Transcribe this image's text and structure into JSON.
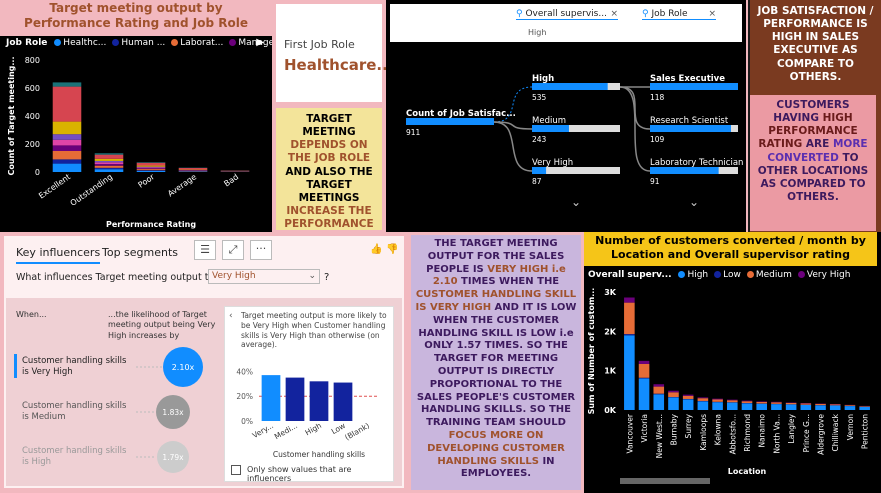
{
  "chart1": {
    "title": "Target meeting output by Performance Rating and Job Role",
    "legend_title": "Job Role",
    "legend": [
      {
        "name": "Healthc...",
        "color": "#118DFF"
      },
      {
        "name": "Human ...",
        "color": "#12239E"
      },
      {
        "name": "Laborat...",
        "color": "#E66C37"
      },
      {
        "name": "Manager",
        "color": "#6B007B"
      }
    ],
    "ylabel": "Count of Target meeting...",
    "xlabel": "Performance Rating"
  },
  "chart_data": [
    {
      "type": "bar",
      "stacked": true,
      "title": "Target meeting output by Performance Rating and Job Role",
      "xlabel": "Performance Rating",
      "ylabel": "Count of Target meeting...",
      "categories": [
        "Excellent",
        "Outstanding",
        "Poor",
        "Average",
        "Bad"
      ],
      "ylim": [
        0,
        800
      ],
      "yticks": [
        "0",
        "200",
        "400",
        "600",
        "800"
      ],
      "segment_colors": [
        "#118DFF",
        "#12239E",
        "#E66C37",
        "#6B007B",
        "#E044A7",
        "#744EC2",
        "#D9B300",
        "#D64550",
        "#197278"
      ],
      "stacks": [
        [
          60,
          30,
          60,
          40,
          40,
          40,
          90,
          250,
          30
        ],
        [
          20,
          10,
          15,
          12,
          12,
          10,
          15,
          30,
          10
        ],
        [
          8,
          5,
          8,
          6,
          6,
          5,
          8,
          20,
          4
        ],
        [
          3,
          2,
          3,
          2,
          2,
          2,
          3,
          12,
          2
        ],
        [
          1,
          1,
          1,
          1,
          1,
          1,
          1,
          3,
          1
        ]
      ]
    },
    {
      "type": "bar",
      "stacked": true,
      "title": "Number of customers converted / month by Location and Overall supervisor rating",
      "xlabel": "Location",
      "ylabel": "Sum of Number of custom...",
      "legend_title": "Overall superv...",
      "series_names": [
        "High",
        "Low",
        "Medium",
        "Very High"
      ],
      "colors": [
        "#118DFF",
        "#12239E",
        "#E66C37",
        "#6B007B"
      ],
      "categories": [
        "Vancouver",
        "Victoria",
        "New West...",
        "Burnaby",
        "Surrey",
        "Kamloops",
        "Kelowna",
        "Abbotsfo...",
        "Richmond",
        "Nanaimo",
        "North Va...",
        "Langley",
        "Prince G...",
        "Aldergrove",
        "Chilliwack",
        "Vernon",
        "Penticton"
      ],
      "ylim": [
        0,
        3000
      ],
      "yticks": [
        "0K",
        "1K",
        "2K",
        "3K"
      ],
      "stacks": [
        [
          1900,
          30,
          800,
          130
        ],
        [
          800,
          20,
          350,
          80
        ],
        [
          400,
          15,
          180,
          60
        ],
        [
          320,
          10,
          120,
          40
        ],
        [
          270,
          10,
          80,
          30
        ],
        [
          220,
          10,
          70,
          20
        ],
        [
          200,
          8,
          60,
          20
        ],
        [
          190,
          8,
          50,
          15
        ],
        [
          170,
          8,
          45,
          15
        ],
        [
          160,
          6,
          40,
          12
        ],
        [
          150,
          6,
          40,
          12
        ],
        [
          140,
          6,
          35,
          10
        ],
        [
          130,
          5,
          30,
          10
        ],
        [
          120,
          5,
          30,
          8
        ],
        [
          115,
          5,
          25,
          8
        ],
        [
          100,
          5,
          20,
          6
        ],
        [
          80,
          4,
          15,
          5
        ]
      ]
    }
  ],
  "card": {
    "label": "First Job Role",
    "value": "Healthcare..."
  },
  "note1": {
    "parts": [
      {
        "t": "TARGET MEETING ",
        "c": "#000"
      },
      {
        "t": "DEPENDS ON THE JOB ROLE",
        "c": "#a0522d"
      },
      {
        "t": " AND ALSO THE TARGET MEETINGS ",
        "c": "#000"
      },
      {
        "t": "INCREASE THE PERFORMANCE RATING.",
        "c": "#a0522d"
      }
    ]
  },
  "decomp": {
    "filter1": "Overall supervis...",
    "filter1_sub": "High",
    "filter2": "Job Role",
    "root": {
      "label": "Count of Job Satisfac...",
      "value": "911"
    },
    "level1": [
      {
        "label": "High",
        "value": "535",
        "bold": true
      },
      {
        "label": "Medium",
        "value": "243",
        "bold": false
      },
      {
        "label": "Very High",
        "value": "87",
        "bold": false
      }
    ],
    "level2": [
      {
        "label": "Sales Executive",
        "value": "118",
        "bold": true
      },
      {
        "label": "Research Scientist",
        "value": "109",
        "bold": false
      },
      {
        "label": "Laboratory Technician",
        "value": "91",
        "bold": false
      }
    ]
  },
  "note_top_right": "JOB SATISFACTION / PERFORMANCE IS HIGH IN SALES EXECUTIVE AS COMPARE TO OTHERS.",
  "note_right": {
    "parts": [
      {
        "t": "CUSTOMERS HAVING ",
        "c": "#3d1a5e"
      },
      {
        "t": "HIGH PERFORMANCE RATING",
        "c": "#6a1b1b"
      },
      {
        "t": " ARE ",
        "c": "#3d1a5e"
      },
      {
        "t": "MORE CONVERTED",
        "c": "#5b2fb0"
      },
      {
        "t": " TO OTHER LOCATIONS AS COMPARED TO OTHERS.",
        "c": "#3d1a5e"
      }
    ]
  },
  "ki": {
    "tab1": "Key influencers",
    "tab2": "Top segments",
    "question": "What influences Target meeting output to be",
    "question_value": "Very High",
    "question_mark": "?",
    "col1": "When...",
    "col2": "...the likelihood of Target meeting output being Very High increases by",
    "influencers": [
      {
        "label": "Customer handling skills is Very High",
        "value": "2.10x"
      },
      {
        "label": "Customer handling skills is Medium",
        "value": "1.83x"
      },
      {
        "label": "Customer handling skills is High",
        "value": "1.79x"
      }
    ],
    "detail_text": "Target meeting output is more likely to be Very High when Customer handling skills is Very High than otherwise (on average).",
    "detail_xlabel": "Customer handling skills",
    "detail_categories": [
      "Very...",
      "Medi...",
      "High",
      "Low",
      "(Blank)"
    ],
    "detail_values": [
      37,
      35,
      32,
      31,
      0
    ],
    "detail_yticks": [
      "20%",
      "40%",
      "0%"
    ],
    "checkbox_label": "Only show values that are influencers"
  },
  "note_mid": {
    "parts": [
      {
        "t": "THE TARGET MEETING OUTPUT FOR THE SALES PEOPLE IS ",
        "c": "#3d1a5e"
      },
      {
        "t": "VERY HIGH i.e 2.10",
        "c": "#a0522d"
      },
      {
        "t": "  TIMES WHEN THE ",
        "c": "#3d1a5e"
      },
      {
        "t": "CUSTOMER HANDLING SKILL IS VERY HIGH",
        "c": "#a0522d"
      },
      {
        "t": " AND IT IS LOW WHEN THE CUSTOMER HANDLING SKILL IS LOW i.e ONLY 1.57 TIMES. SO THE TARGET FOR MEETING OUTPUT IS DIRECTLY PROPORTIONAL TO THE SALES PEOPLE'S CUSTOMER HANDLING SKILLS.  SO THE TRAINING TEAM SHOULD ",
        "c": "#3d1a5e"
      },
      {
        "t": "FOCUS MORE ON DEVELOPING CUSTOMER HANDLING SKILLS",
        "c": "#a0522d"
      },
      {
        "t": " IN EMPLOYEES.",
        "c": "#3d1a5e"
      }
    ]
  },
  "chart2": {
    "title": "Number of customers converted / month by Location and Overall supervisor rating",
    "legend_title": "Overall superv...",
    "legend": [
      {
        "name": "High",
        "color": "#118DFF"
      },
      {
        "name": "Low",
        "color": "#12239E"
      },
      {
        "name": "Medium",
        "color": "#E66C37"
      },
      {
        "name": "Very High",
        "color": "#6B007B"
      }
    ],
    "ylabel": "Sum of Number of custom...",
    "xlabel": "Location"
  }
}
